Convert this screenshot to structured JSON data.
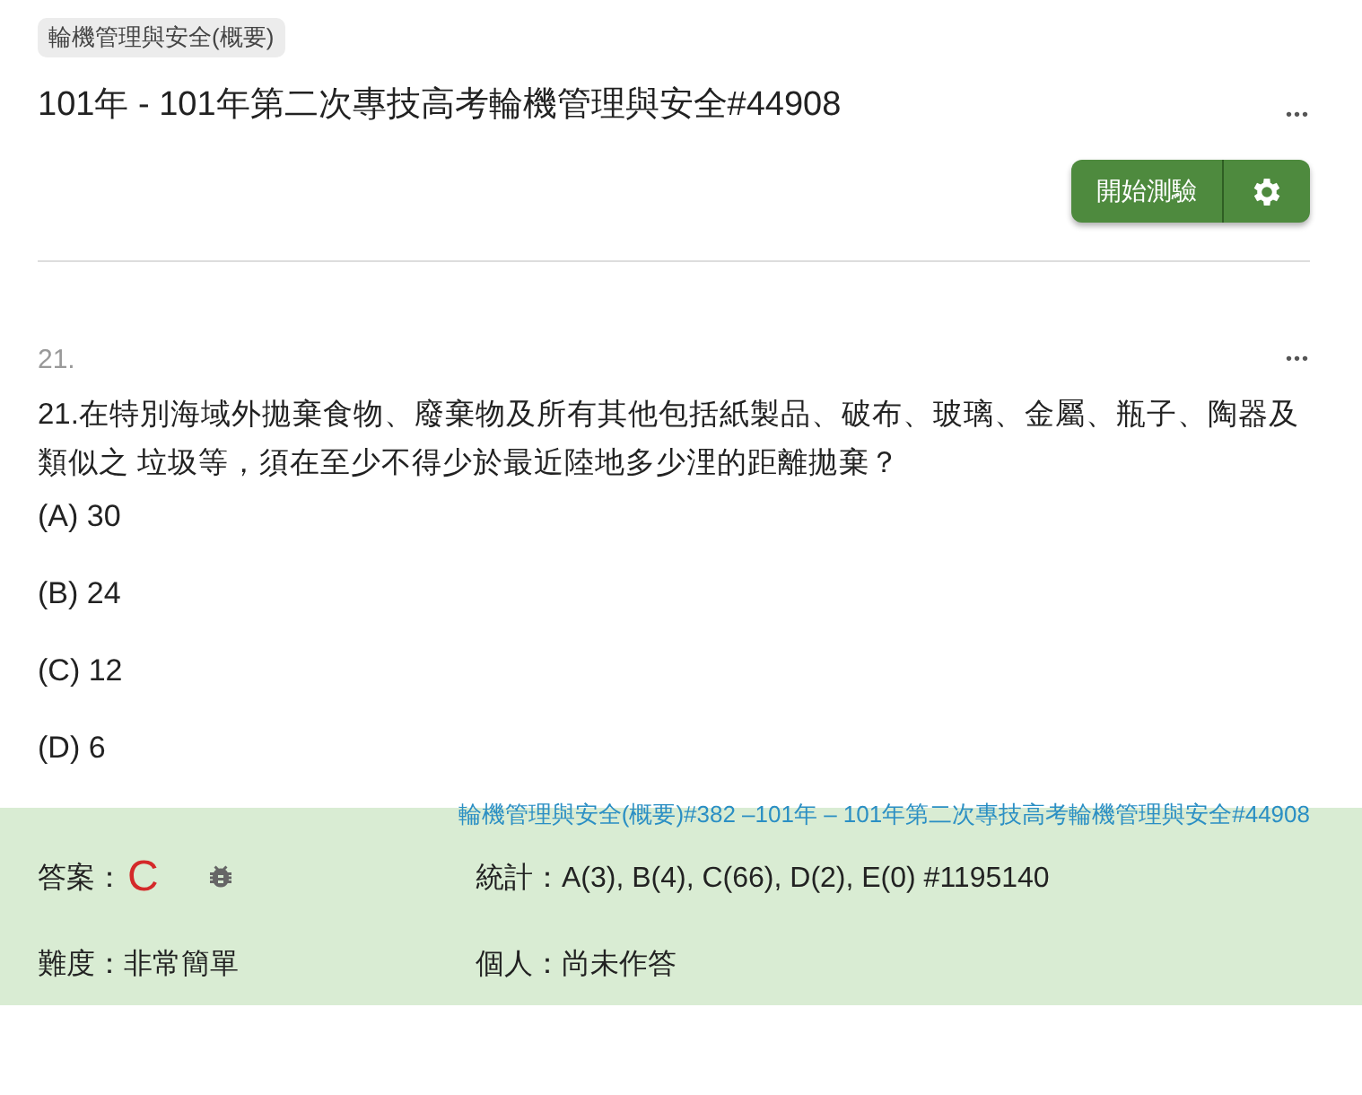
{
  "header": {
    "tag": "輪機管理與安全(概要)",
    "title": "101年 - 101年第二次專技高考輪機管理與安全#44908",
    "more": "•••",
    "start_button": "開始測驗"
  },
  "question": {
    "number": "21.",
    "more": "•••",
    "text": "21.在特別海域外拋棄食物、廢棄物及所有其他包括紙製品、破布、玻璃、金屬、瓶子、陶器及類似之 垃圾等，須在至少不得少於最近陸地多少浬的距離拋棄？",
    "options": [
      "(A) 30",
      "(B) 24",
      "(C) 12",
      "(D) 6"
    ],
    "source_links": [
      "輪機管理與安全(概要)#382",
      "101年 – 101年第二次專技高考輪機管理與安全#44908"
    ],
    "source_separator": "–"
  },
  "answer_panel": {
    "answer_label": "答案：",
    "answer": "C",
    "stats": "統計：A(3), B(4), C(66), D(2), E(0) #1195140",
    "difficulty": "難度：非常簡單",
    "personal": "個人：尚未作答"
  }
}
